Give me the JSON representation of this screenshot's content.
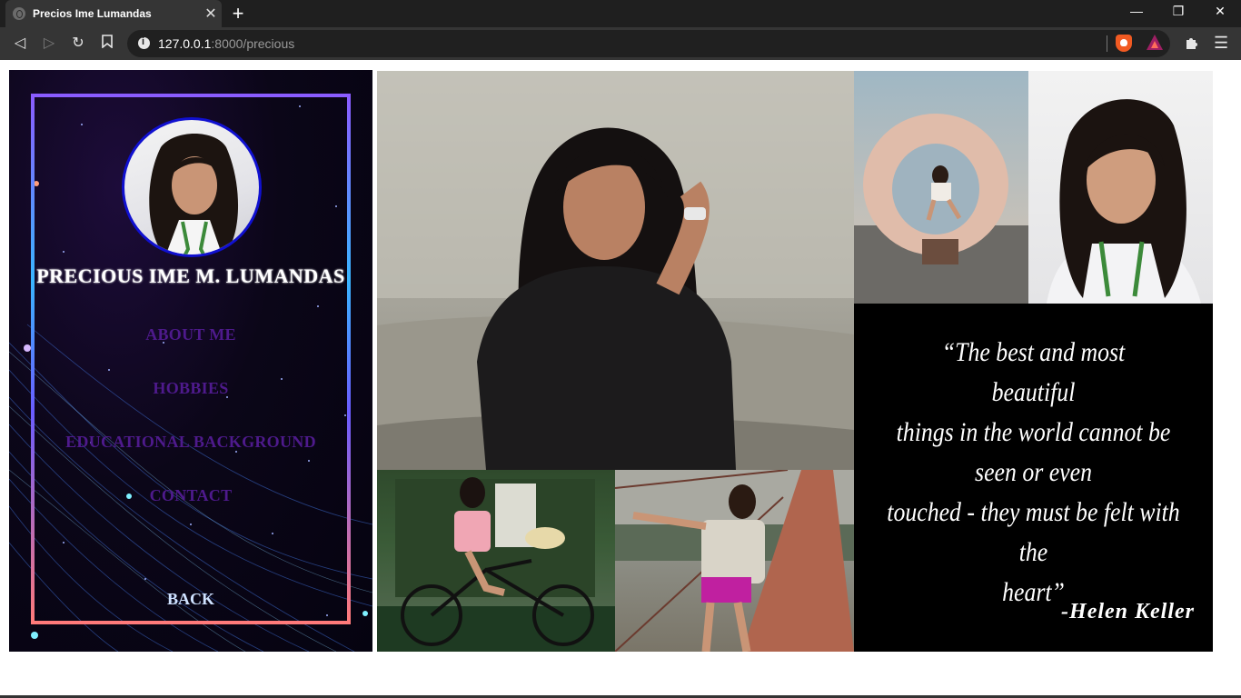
{
  "browser": {
    "tab_title": "Precios Ime Lumandas",
    "tab_close": "✕",
    "new_tab": "+",
    "url_host": "127.0.0.1",
    "url_path": ":8000/precious",
    "window_controls": [
      "—",
      "❐",
      "✕"
    ]
  },
  "sidebar": {
    "name": "PRECIOUS IME M. LUMANDAS",
    "links": [
      "ABOUT ME",
      "HOBBIES",
      "EDUCATIONAL BACKGROUND",
      "CONTACT"
    ],
    "back": "BACK"
  },
  "quote": {
    "lines": [
      "“The best and most",
      "beautiful",
      "things in the world cannot be",
      "seen or even",
      "touched - they must be felt with the",
      "heart”"
    ],
    "author": "-Helen Keller"
  },
  "colors": {
    "link": "#4e1a8c",
    "frame_top": "#8a5cff",
    "frame_mid": "#3ab5ff",
    "frame_bottom": "#ff7a7a"
  }
}
